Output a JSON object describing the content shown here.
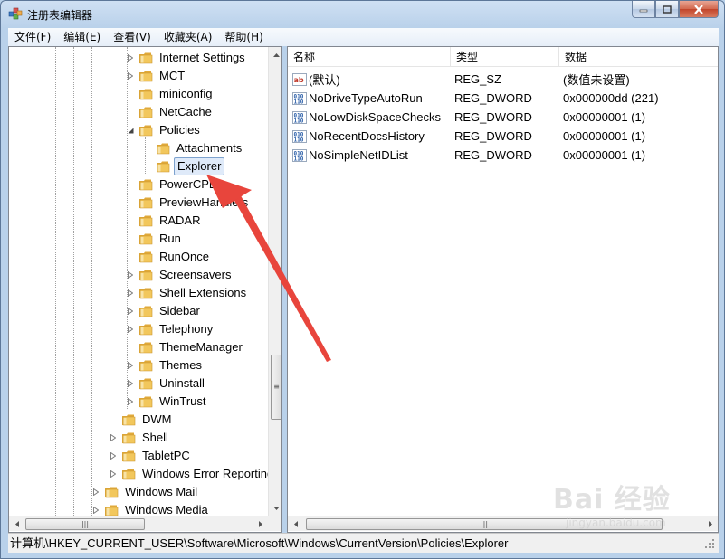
{
  "window": {
    "title": "注册表编辑器"
  },
  "menu": [
    {
      "label": "文件(F)"
    },
    {
      "label": "编辑(E)"
    },
    {
      "label": "查看(V)"
    },
    {
      "label": "收藏夹(A)"
    },
    {
      "label": "帮助(H)"
    }
  ],
  "tree": {
    "items": [
      {
        "label": "Internet Settings",
        "expander": "collapsed"
      },
      {
        "label": "MCT",
        "expander": "collapsed"
      },
      {
        "label": "miniconfig",
        "expander": "none"
      },
      {
        "label": "NetCache",
        "expander": "none"
      },
      {
        "label": "Policies",
        "expander": "expanded"
      },
      {
        "label": "Attachments",
        "expander": "none"
      },
      {
        "label": "Explorer",
        "expander": "none",
        "selected": true
      },
      {
        "label": "PowerCPL",
        "expander": "none"
      },
      {
        "label": "PreviewHandlers",
        "expander": "none"
      },
      {
        "label": "RADAR",
        "expander": "none"
      },
      {
        "label": "Run",
        "expander": "none"
      },
      {
        "label": "RunOnce",
        "expander": "none"
      },
      {
        "label": "Screensavers",
        "expander": "collapsed"
      },
      {
        "label": "Shell Extensions",
        "expander": "collapsed"
      },
      {
        "label": "Sidebar",
        "expander": "collapsed"
      },
      {
        "label": "Telephony",
        "expander": "collapsed"
      },
      {
        "label": "ThemeManager",
        "expander": "none"
      },
      {
        "label": "Themes",
        "expander": "collapsed"
      },
      {
        "label": "Uninstall",
        "expander": "collapsed"
      },
      {
        "label": "WinTrust",
        "expander": "collapsed"
      },
      {
        "label": "DWM",
        "expander": "none"
      },
      {
        "label": "Shell",
        "expander": "collapsed"
      },
      {
        "label": "TabletPC",
        "expander": "collapsed"
      },
      {
        "label": "Windows Error Reporting",
        "expander": "collapsed"
      },
      {
        "label": "Windows Mail",
        "expander": "collapsed"
      },
      {
        "label": "Windows Media",
        "expander": "collapsed"
      }
    ]
  },
  "list": {
    "columns": [
      {
        "label": "名称"
      },
      {
        "label": "类型"
      },
      {
        "label": "数据"
      }
    ],
    "rows": [
      {
        "icon": "string-value-icon",
        "name": "(默认)",
        "type": "REG_SZ",
        "data": "(数值未设置)"
      },
      {
        "icon": "dword-value-icon",
        "name": "NoDriveTypeAutoRun",
        "type": "REG_DWORD",
        "data": "0x000000dd (221)"
      },
      {
        "icon": "dword-value-icon",
        "name": "NoLowDiskSpaceChecks",
        "type": "REG_DWORD",
        "data": "0x00000001 (1)"
      },
      {
        "icon": "dword-value-icon",
        "name": "NoRecentDocsHistory",
        "type": "REG_DWORD",
        "data": "0x00000001 (1)"
      },
      {
        "icon": "dword-value-icon",
        "name": "NoSimpleNetIDList",
        "type": "REG_DWORD",
        "data": "0x00000001 (1)"
      }
    ]
  },
  "status": {
    "path": "计算机\\HKEY_CURRENT_USER\\Software\\Microsoft\\Windows\\CurrentVersion\\Policies\\Explorer"
  },
  "watermark": {
    "brand": "Bai 经验",
    "url": "jingyan.baidu.com"
  },
  "colors": {
    "folder": "#f2c75c",
    "selection": "#dfeaf9",
    "annotation_arrow": "#e8453c"
  }
}
